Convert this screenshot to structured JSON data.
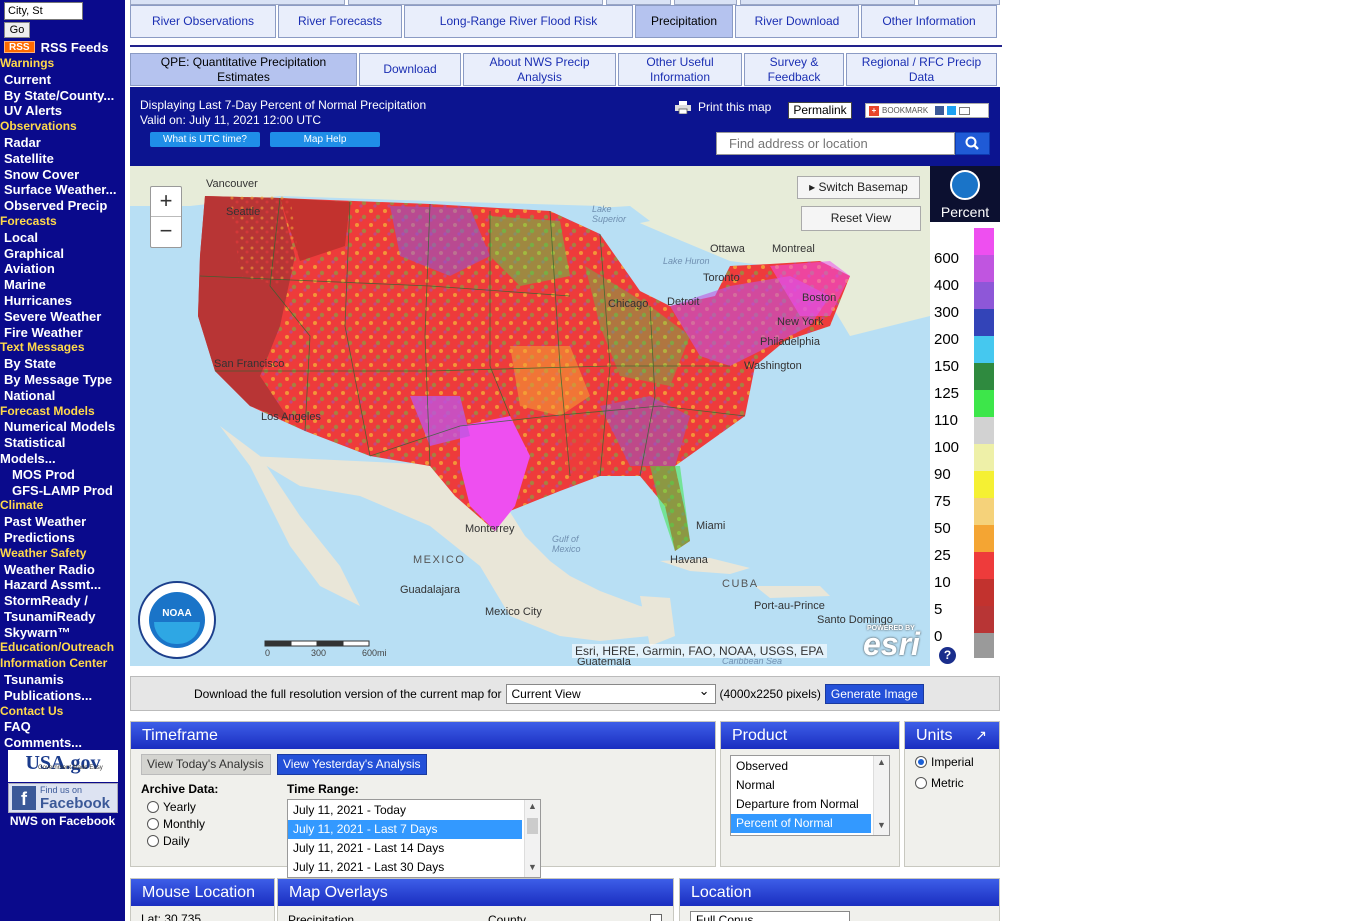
{
  "sidebar": {
    "location_input": "City, St",
    "go_label": "Go",
    "rss_badge": "RSS",
    "rss_label": "RSS Feeds",
    "nav": [
      {
        "type": "hd",
        "label": "Warnings"
      },
      {
        "type": "it",
        "label": "Current"
      },
      {
        "type": "it",
        "label": "By State/County..."
      },
      {
        "type": "it",
        "label": "UV Alerts"
      },
      {
        "type": "hd",
        "label": "Observations"
      },
      {
        "type": "it",
        "label": "Radar"
      },
      {
        "type": "it",
        "label": "Satellite"
      },
      {
        "type": "it",
        "label": "Snow Cover"
      },
      {
        "type": "it",
        "label": "Surface Weather..."
      },
      {
        "type": "it",
        "label": "Observed Precip"
      },
      {
        "type": "hd",
        "label": "Forecasts"
      },
      {
        "type": "it",
        "label": "Local"
      },
      {
        "type": "it",
        "label": "Graphical"
      },
      {
        "type": "it",
        "label": "Aviation"
      },
      {
        "type": "it",
        "label": "Marine"
      },
      {
        "type": "it",
        "label": "Hurricanes"
      },
      {
        "type": "it",
        "label": "Severe Weather"
      },
      {
        "type": "it",
        "label": "Fire Weather"
      },
      {
        "type": "hd",
        "label": "Text Messages"
      },
      {
        "type": "it",
        "label": "By State"
      },
      {
        "type": "it",
        "label": "By Message Type"
      },
      {
        "type": "it",
        "label": "National"
      },
      {
        "type": "hd",
        "label": "Forecast Models"
      },
      {
        "type": "it",
        "label": "Numerical Models"
      },
      {
        "type": "it",
        "label": "Statistical"
      },
      {
        "type": "hd2",
        "label": "Models..."
      },
      {
        "type": "sub",
        "label": "MOS Prod"
      },
      {
        "type": "sub",
        "label": "GFS-LAMP Prod"
      },
      {
        "type": "hd",
        "label": "Climate"
      },
      {
        "type": "it",
        "label": "Past Weather"
      },
      {
        "type": "it",
        "label": "Predictions"
      },
      {
        "type": "hd",
        "label": "Weather Safety"
      },
      {
        "type": "it",
        "label": "Weather Radio"
      },
      {
        "type": "it",
        "label": "Hazard Assmt..."
      },
      {
        "type": "it",
        "label": "StormReady /"
      },
      {
        "type": "it",
        "label": "TsunamiReady"
      },
      {
        "type": "it",
        "label": "Skywarn™"
      },
      {
        "type": "hd",
        "label": "Education/Outreach"
      },
      {
        "type": "hd",
        "label": "Information Center"
      },
      {
        "type": "it",
        "label": "Tsunamis"
      },
      {
        "type": "it",
        "label": "Publications..."
      },
      {
        "type": "hd",
        "label": "Contact Us"
      },
      {
        "type": "it",
        "label": "FAQ"
      },
      {
        "type": "it",
        "label": "Comments..."
      }
    ],
    "usagov_label": "USA.gov",
    "usagov_tag": "Government Made Easy",
    "fb_find": "Find us on",
    "fb_label": "Facebook",
    "nws_facebook": "NWS on Facebook"
  },
  "nav_primary": [
    {
      "label": "River Observations",
      "active": false
    },
    {
      "label": "River Forecasts",
      "active": false
    },
    {
      "label": "Long-Range River Flood Risk",
      "active": false
    },
    {
      "label": "Precipitation",
      "active": true
    },
    {
      "label": "River Download",
      "active": false
    },
    {
      "label": "Other Information",
      "active": false
    }
  ],
  "nav_secondary": [
    {
      "label": "QPE: Quantitative Precipitation Estimates",
      "active": true
    },
    {
      "label": "Download",
      "active": false
    },
    {
      "label": "About NWS Precip Analysis",
      "active": false
    },
    {
      "label": "Other Useful Information",
      "active": false
    },
    {
      "label": "Survey & Feedback",
      "active": false
    },
    {
      "label": "Regional / RFC Precip Data",
      "active": false
    }
  ],
  "banner": {
    "line1": "Displaying Last 7-Day Percent of Normal Precipitation",
    "line2": "Valid on: July 11, 2021 12:00 UTC",
    "utc_button": "What is UTC time?",
    "help_button": "Map Help",
    "print_label": "Print this map",
    "permalink_label": "Permalink",
    "bookmark_label": "BOOKMARK",
    "search_placeholder": "Find address or location"
  },
  "map": {
    "switch_basemap": "Switch Basemap",
    "reset_view": "Reset View",
    "zoom_in": "+",
    "zoom_out": "−",
    "scale_labels": [
      "0",
      "300",
      "600mi"
    ],
    "attribution": "Esri, HERE, Garmin, FAO, NOAA, USGS, EPA",
    "esri_powered": "POWERED BY",
    "esri_label": "esri",
    "seal_label": "NOAA",
    "places": [
      {
        "name": "Vancouver",
        "kind": "city"
      },
      {
        "name": "Seattle",
        "kind": "city"
      },
      {
        "name": "San Francisco",
        "kind": "city"
      },
      {
        "name": "Los Angeles",
        "kind": "city"
      },
      {
        "name": "Monterrey",
        "kind": "city"
      },
      {
        "name": "Guadalajara",
        "kind": "city"
      },
      {
        "name": "Mexico City",
        "kind": "city"
      },
      {
        "name": "Havana",
        "kind": "city"
      },
      {
        "name": "Miami",
        "kind": "city"
      },
      {
        "name": "Chicago",
        "kind": "city"
      },
      {
        "name": "Detroit",
        "kind": "city"
      },
      {
        "name": "Toronto",
        "kind": "city"
      },
      {
        "name": "Ottawa",
        "kind": "city"
      },
      {
        "name": "Montreal",
        "kind": "city"
      },
      {
        "name": "Boston",
        "kind": "city"
      },
      {
        "name": "New York",
        "kind": "city"
      },
      {
        "name": "Philadelphia",
        "kind": "city"
      },
      {
        "name": "Washington",
        "kind": "city"
      },
      {
        "name": "Port-au-Prince",
        "kind": "city"
      },
      {
        "name": "Santo Domingo",
        "kind": "city"
      },
      {
        "name": "Guatemala",
        "kind": "city"
      },
      {
        "name": "Lake Superior",
        "kind": "water"
      },
      {
        "name": "Lake Huron",
        "kind": "water"
      },
      {
        "name": "Gulf of Mexico",
        "kind": "water"
      },
      {
        "name": "Caribbean Sea",
        "kind": "water"
      },
      {
        "name": "MEXICO",
        "kind": "country"
      },
      {
        "name": "CUBA",
        "kind": "country"
      }
    ]
  },
  "legend": {
    "title": "Percent",
    "items": [
      {
        "label": "600",
        "color": "#ee4ff0"
      },
      {
        "label": "400",
        "color": "#c055e0"
      },
      {
        "label": "300",
        "color": "#8e57d8"
      },
      {
        "label": "200",
        "color": "#3344b8"
      },
      {
        "label": "150",
        "color": "#45c8ef"
      },
      {
        "label": "125",
        "color": "#2f8a3f"
      },
      {
        "label": "110",
        "color": "#3de64a"
      },
      {
        "label": "100",
        "color": "#d2d2d2"
      },
      {
        "label": "90",
        "color": "#eef0a8"
      },
      {
        "label": "75",
        "color": "#f5f033"
      },
      {
        "label": "50",
        "color": "#f5d27a"
      },
      {
        "label": "25",
        "color": "#f4a533"
      },
      {
        "label": "10",
        "color": "#ee3b3b"
      },
      {
        "label": "5",
        "color": "#c2322e"
      },
      {
        "label": "0",
        "color": "#b83535"
      }
    ],
    "help_label": "?"
  },
  "download_bar": {
    "prefix": "Download the full resolution version of the current map for",
    "select_value": "Current View",
    "pixels": "(4000x2250 pixels)",
    "generate_label": "Generate Image"
  },
  "timeframe": {
    "title": "Timeframe",
    "today_button": "View Today's Analysis",
    "yesterday_button": "View Yesterday's Analysis",
    "archive_label": "Archive Data:",
    "archive_options": [
      "Yearly",
      "Monthly",
      "Daily"
    ],
    "range_label": "Time Range:",
    "range_options": [
      {
        "label": "July 11, 2021 - Today",
        "selected": false
      },
      {
        "label": "July 11, 2021 - Last 7 Days",
        "selected": true
      },
      {
        "label": "July 11, 2021 - Last 14 Days",
        "selected": false
      },
      {
        "label": "July 11, 2021 - Last 30 Days",
        "selected": false
      }
    ]
  },
  "product": {
    "title": "Product",
    "options": [
      {
        "label": "Observed",
        "selected": false
      },
      {
        "label": "Normal",
        "selected": false
      },
      {
        "label": "Departure from Normal",
        "selected": false
      },
      {
        "label": "Percent of Normal",
        "selected": true
      }
    ]
  },
  "units": {
    "title": "Units",
    "expand_icon": "↗",
    "options": [
      {
        "label": "Imperial",
        "selected": true
      },
      {
        "label": "Metric",
        "selected": false
      }
    ]
  },
  "mouse_location": {
    "title": "Mouse Location",
    "lat": "Lat: 30.735"
  },
  "map_overlays": {
    "title": "Map Overlays",
    "item1": "Precipitation",
    "item2": "County"
  },
  "location_panel": {
    "title": "Location",
    "select_value": "Full Conus"
  }
}
